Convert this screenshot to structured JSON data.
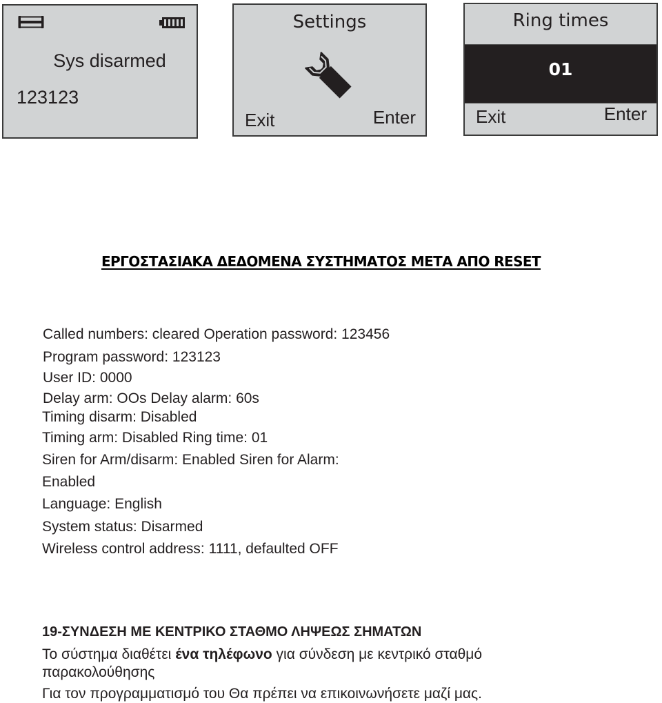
{
  "screens": {
    "home": {
      "signal_icon": "signal-bar-icon",
      "battery_icon": "battery-full-icon",
      "status": "Sys disarmed",
      "code": "123123"
    },
    "settings": {
      "title": "Settings",
      "icon": "wrench-icon",
      "left_softkey": "Exit",
      "right_softkey": "Enter"
    },
    "ring_times": {
      "title": "Ring times",
      "value": "01",
      "left_softkey": "Exit",
      "right_softkey": "Enter"
    }
  },
  "factory_defaults": {
    "heading": "ΕΡΓΟΣΤΑΣΙΑΚΑ ΔΕΔΟΜΕΝΑ ΣΥΣΤΗΜΑΤΟΣ ΜΕΤΑ ΑΠΟ RESET",
    "lines": [
      "Called numbers: cleared Operation password:  123456",
      "Program password:  123123",
      "User ID:  0000",
      "Delay arm: OOs Delay  alarm: 60s",
      "Timing disarm:  Disabled",
      "Timing arm:  Disabled Ring time:  01",
      "Siren for Arm/disarm:  Enabled Siren for Alarm:",
      "Enabled",
      "Language:  English",
      "System status: Disarmed",
      "Wireless control address:  1111, defaulted OFF"
    ]
  },
  "section_19": {
    "title": "19-ΣΥΝΔΕΣΗ ΜΕ ΚΕΝΤΡΙΚΟ ΣΤΑΘΜΟ ΛΗΨΕΩΣ ΣΗΜΑΤΩΝ",
    "para1_before": "Το σύστημα διαθέτει ",
    "para1_bold": "ένα τηλέφωνο",
    "para1_after": " για σύνδεση με κεντρικό σταθμό",
    "para1_cont": "παρακολούθησης",
    "para2": "Για τον προγραμματισμό του Θα πρέπει να επικοινωνήσετε μαζί μας."
  }
}
